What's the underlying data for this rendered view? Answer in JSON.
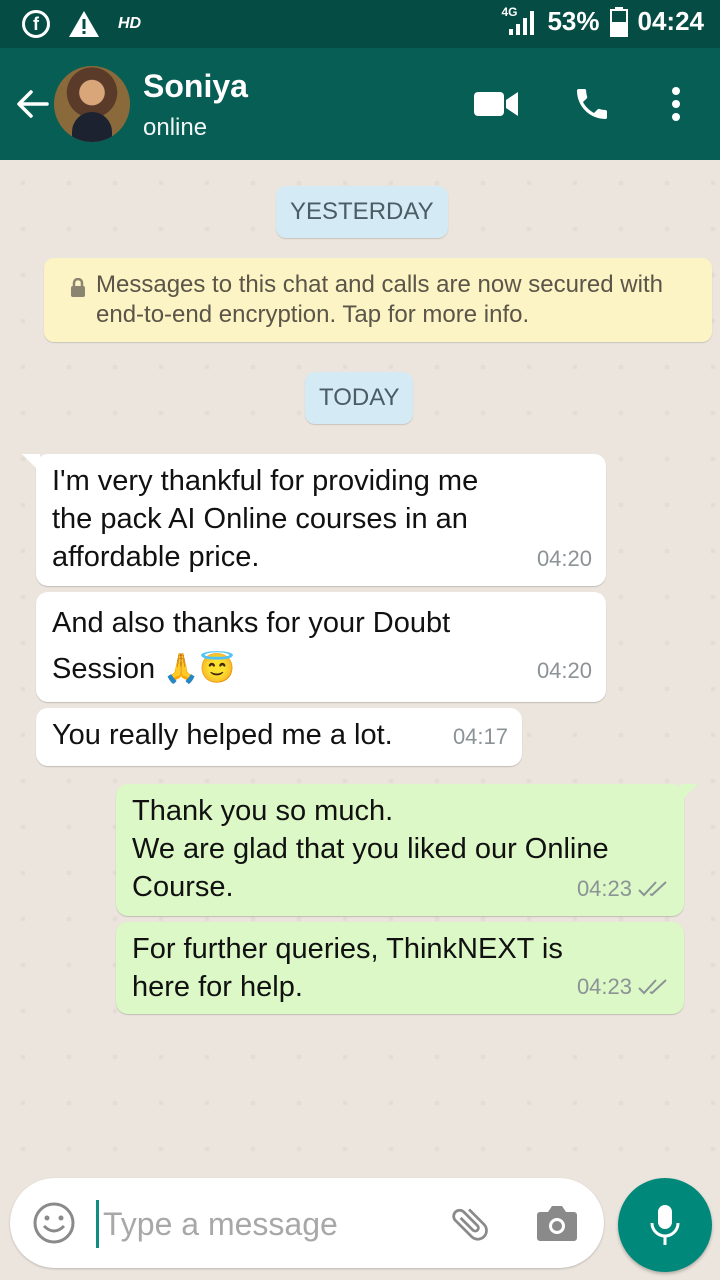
{
  "status_bar": {
    "hd": "HD",
    "network": "4G",
    "battery": "53%",
    "time": "04:24"
  },
  "contact": {
    "name": "Soniya",
    "presence": "online"
  },
  "dates": {
    "yesterday": "YESTERDAY",
    "today": "TODAY"
  },
  "encryption_notice": "Messages to this chat and calls are now secured with end-to-end encryption. Tap for more info.",
  "messages": [
    {
      "text": "I'm very thankful for providing me\nthe pack AI Online courses in an\naffordable price.",
      "time": "04:20",
      "direction": "in"
    },
    {
      "text": "And also thanks for your Doubt\nSession 🙏😇",
      "time": "04:20",
      "direction": "in"
    },
    {
      "text": "You really helped me a lot.",
      "time": "04:17",
      "direction": "in"
    },
    {
      "text": "Thank you so much.\nWe are glad that you liked our Online\nCourse.",
      "time": "04:23",
      "direction": "out",
      "status": "read"
    },
    {
      "text": "For further queries, ThinkNEXT is\nhere for help.",
      "time": "04:23",
      "direction": "out",
      "status": "read"
    }
  ],
  "composer": {
    "placeholder": "Type a message"
  },
  "colors": {
    "header": "#075E54",
    "status_bar": "#054D44",
    "outgoing_bubble": "#DCF8C6",
    "incoming_bubble": "#FFFFFF",
    "accent": "#00897B"
  },
  "icons": [
    "facebook-icon",
    "warning-icon",
    "signal-icon",
    "battery-icon",
    "back-arrow-icon",
    "video-call-icon",
    "voice-call-icon",
    "more-options-icon",
    "lock-icon",
    "emoji-icon",
    "attach-icon",
    "camera-icon",
    "mic-icon",
    "read-ticks-icon"
  ]
}
